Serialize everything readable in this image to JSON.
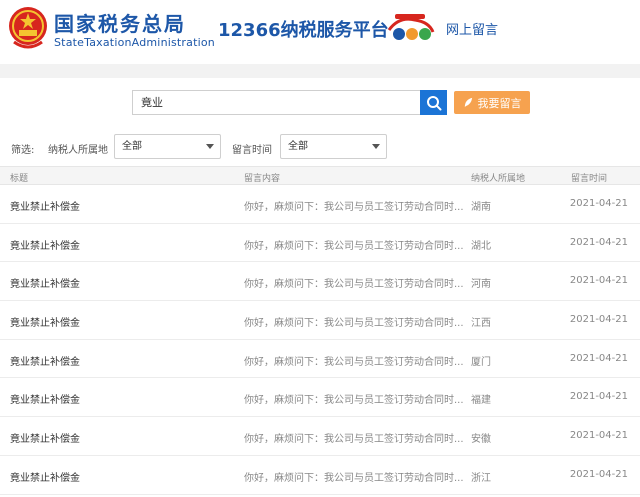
{
  "header": {
    "brand_cn": "国家税务总局",
    "brand_en": "StateTaxationAdministration",
    "platform_title": "12366纳税服务平台",
    "section_title": "网上留言"
  },
  "search": {
    "query": "竟业",
    "search_icon": "search-icon",
    "post_button_label": "我要留言",
    "post_icon": "leaf-pen-icon"
  },
  "filters": {
    "label": "筛选:",
    "region_label": "纳税人所属地",
    "region_value": "全部",
    "time_label": "留言时间",
    "time_value": "全部"
  },
  "table": {
    "headers": {
      "title": "标题",
      "content": "留言内容",
      "region": "纳税人所属地",
      "date": "留言时间"
    },
    "rows": [
      {
        "title": "竟业禁止补偿金",
        "content": "你好，麻烦问下：我公司与员工签订劳动合同时...",
        "region": "湖南",
        "date": "2021-04-21"
      },
      {
        "title": "竟业禁止补偿金",
        "content": "你好，麻烦问下：我公司与员工签订劳动合同时...",
        "region": "湖北",
        "date": "2021-04-21"
      },
      {
        "title": "竟业禁止补偿金",
        "content": "你好，麻烦问下：我公司与员工签订劳动合同时...",
        "region": "河南",
        "date": "2021-04-21"
      },
      {
        "title": "竟业禁止补偿金",
        "content": "你好，麻烦问下：我公司与员工签订劳动合同时...",
        "region": "江西",
        "date": "2021-04-21"
      },
      {
        "title": "竟业禁止补偿金",
        "content": "你好，麻烦问下：我公司与员工签订劳动合同时...",
        "region": "厦门",
        "date": "2021-04-21"
      },
      {
        "title": "竟业禁止补偿金",
        "content": "你好，麻烦问下：我公司与员工签订劳动合同时...",
        "region": "福建",
        "date": "2021-04-21"
      },
      {
        "title": "竟业禁止补偿金",
        "content": "你好，麻烦问下：我公司与员工签订劳动合同时...",
        "region": "安徽",
        "date": "2021-04-21"
      },
      {
        "title": "竟业禁止补偿金",
        "content": "你好，麻烦问下：我公司与员工签订劳动合同时...",
        "region": "浙江",
        "date": "2021-04-21"
      }
    ]
  },
  "colors": {
    "brand_blue": "#1d57a8",
    "search_blue": "#1b74d6",
    "post_orange": "#f6a24f"
  }
}
